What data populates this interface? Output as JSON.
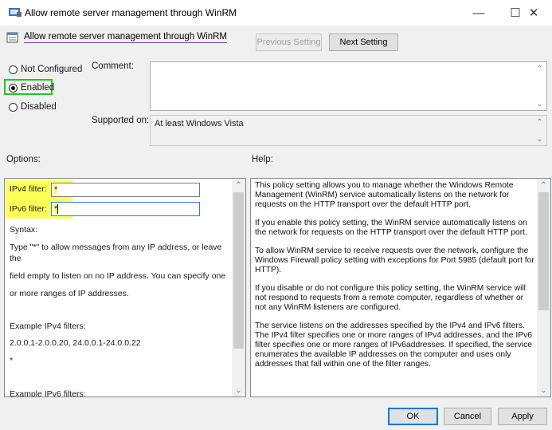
{
  "window": {
    "title": "Allow remote server management through WinRM",
    "controls": {
      "minimize": "—",
      "maximize": "☐",
      "close": "✕"
    }
  },
  "header": {
    "setting_title": "Allow remote server management through WinRM",
    "prev_label": "Previous Setting",
    "next_label": "Next Setting"
  },
  "state": {
    "options": [
      {
        "label": "Not Configured",
        "checked": false
      },
      {
        "label": "Enabled",
        "checked": true
      },
      {
        "label": "Disabled",
        "checked": false
      }
    ]
  },
  "comment": {
    "label": "Comment:",
    "value": ""
  },
  "supported": {
    "label": "Supported on:",
    "value": "At least Windows Vista"
  },
  "options_panel": {
    "heading": "Options:",
    "ipv4_label": "IPv4 filter:",
    "ipv4_value": "*",
    "ipv6_label": "IPv6 filter:",
    "ipv6_value": "*",
    "lines": [
      "Syntax:",
      "Type \"*\" to allow messages from any IP address, or leave",
      "the",
      "field empty to listen on no IP address. You can specify one",
      "or more ranges of IP addresses.",
      "Example IPv4 filters:",
      "2.0.0.1-2.0.0.20, 24.0.0.1-24.0.0.22",
      "*",
      "Example IPv6 filters:"
    ]
  },
  "help_panel": {
    "heading": "Help:",
    "paragraphs": [
      "This policy setting allows you to manage whether the Windows Remote Management (WinRM) service automatically listens on the network for requests on the HTTP transport over the default HTTP port.",
      "If you enable this policy setting, the WinRM service automatically listens on the network for requests on the HTTP transport over the default HTTP port.",
      "To allow WinRM service to receive requests over the network, configure the Windows Firewall policy setting with exceptions for Port 5985 (default port for HTTP).",
      "If you disable or do not configure this policy setting, the WinRM service will not respond to requests from a remote computer, regardless of whether or not any WinRM listeners are configured.",
      "The service listens on the addresses specified by the IPv4 and IPv6 filters. The IPv4 filter specifies one or more ranges of IPv4 addresses, and the IPv6 filter specifies one or more ranges of IPv6addresses. If specified, the service enumerates the available IP addresses on the computer and uses only addresses that fall within one of the filter ranges."
    ]
  },
  "footer": {
    "ok_label": "OK",
    "cancel_label": "Cancel",
    "apply_label": "Apply"
  }
}
